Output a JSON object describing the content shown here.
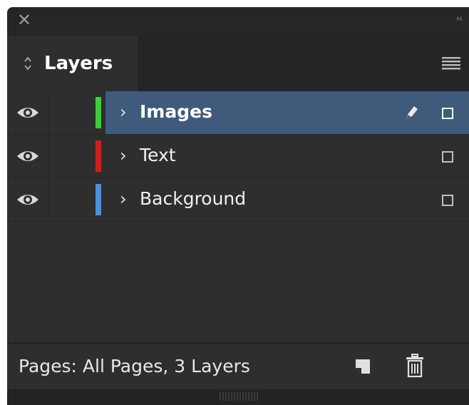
{
  "window": {
    "close_glyph": "✕",
    "collapse_glyph": "‹‹"
  },
  "tab": {
    "label": "Layers",
    "arrows_icon": "up-down-arrows-icon",
    "menu_icon": "panel-menu-icon"
  },
  "layers": [
    {
      "name": "Images",
      "color": "#35d13a",
      "visible": true,
      "selected": true,
      "target_layer": true
    },
    {
      "name": "Text",
      "color": "#d81b1b",
      "visible": true,
      "selected": false,
      "target_layer": false
    },
    {
      "name": "Background",
      "color": "#4a90e2",
      "visible": true,
      "selected": false,
      "target_layer": false
    }
  ],
  "footer": {
    "status": "Pages: All Pages, 3 Layers",
    "new_layer_icon": "new-layer-icon",
    "delete_icon": "trash-icon"
  },
  "colors": {
    "panel_bg": "#2e2e2e",
    "selected_row": "#3f5a7a"
  }
}
